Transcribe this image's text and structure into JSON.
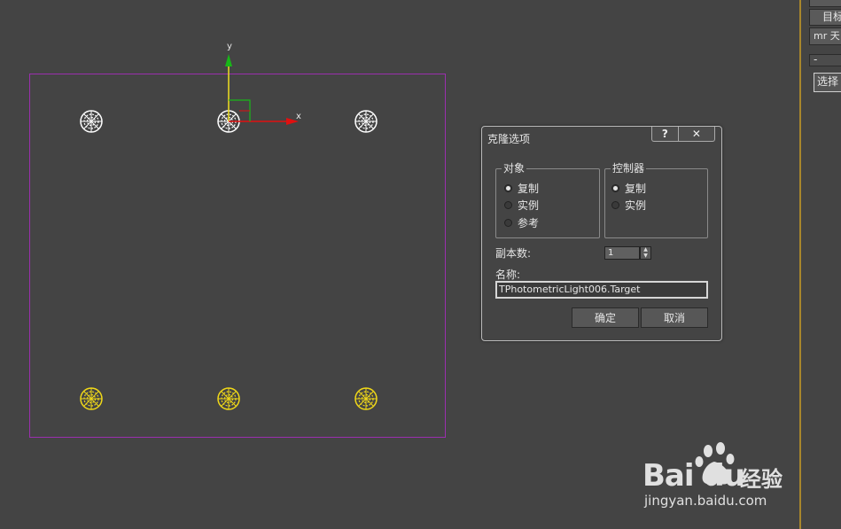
{
  "viewport": {
    "gizmo": {
      "y_axis": "y",
      "x_axis": "x"
    },
    "lights_top_color": "#ffffff",
    "lights_bottom_color": "#f0d818",
    "selection_color": "#9b2fae"
  },
  "right_panel": {
    "btn1": "目标",
    "btn2": "mr 天",
    "rollout_minus": "-",
    "btn3": "选择"
  },
  "clone_dialog": {
    "title": "克隆选项",
    "help_btn": "?",
    "close_btn": "✕",
    "object_group": {
      "title": "对象",
      "options": [
        "复制",
        "实例",
        "参考"
      ],
      "selected": 0
    },
    "controller_group": {
      "title": "控制器",
      "options": [
        "复制",
        "实例"
      ],
      "selected": 0
    },
    "copies_label": "副本数:",
    "copies_value": "1",
    "name_label": "名称:",
    "name_value": "TPhotometricLight006.Target",
    "ok_label": "确定",
    "cancel_label": "取消"
  },
  "watermark": {
    "brand": "Bai du",
    "sub": "经验",
    "url": "jingyan.baidu.com"
  }
}
